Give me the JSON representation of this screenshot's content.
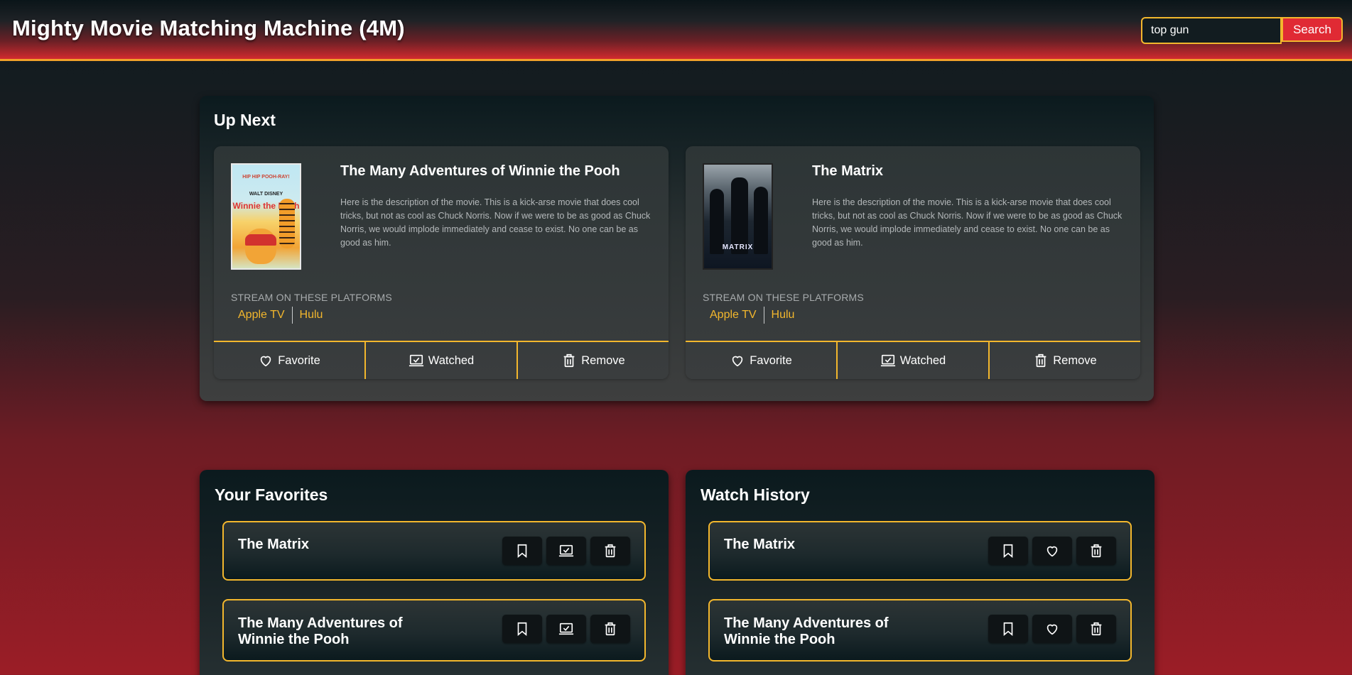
{
  "header": {
    "title": "Mighty Movie Matching Machine (4M)",
    "search_value": "top gun",
    "search_button": "Search"
  },
  "up_next": {
    "title": "Up Next",
    "stream_label": "STREAM ON THESE PLATFORMS",
    "actions": {
      "favorite": "Favorite",
      "watched": "Watched",
      "remove": "Remove"
    },
    "movies": [
      {
        "title": "The Many Adventures of Winnie the Pooh",
        "description": "Here is the description of the movie. This is a kick-arse movie that does cool tricks, but not as cool as Chuck Norris. Now if we were to be as good as Chuck Norris, we would implode immediately and cease to exist. No one can be as good as him.",
        "platforms": [
          "Apple TV",
          "Hulu"
        ],
        "poster_text": {
          "top": "HIP HIP POOH-RAY!",
          "studio": "WALT DISNEY",
          "name": "Winnie the Pooh"
        }
      },
      {
        "title": "The Matrix",
        "description": "Here is the description of the movie. This is a kick-arse movie that does cool tricks, but not as cool as Chuck Norris. Now if we were to be as good as Chuck Norris, we would implode immediately and cease to exist. No one can be as good as him.",
        "platforms": [
          "Apple TV",
          "Hulu"
        ],
        "poster_text": {
          "name": "MATRIX"
        }
      }
    ]
  },
  "favorites": {
    "title": "Your Favorites",
    "items": [
      {
        "title": "The Matrix"
      },
      {
        "title": "The Many Adventures of Winnie the Pooh"
      }
    ]
  },
  "history": {
    "title": "Watch History",
    "items": [
      {
        "title": "The Matrix"
      },
      {
        "title": "The Many Adventures of Winnie the Pooh"
      }
    ]
  },
  "colors": {
    "accent": "#f3b72d",
    "search_button": "#e02a34",
    "header_red": "#d12a2e"
  },
  "icons": {
    "favorite": "heart-icon",
    "watched": "laptop-check-icon",
    "remove": "trash-icon",
    "bookmark": "bookmark-icon"
  }
}
